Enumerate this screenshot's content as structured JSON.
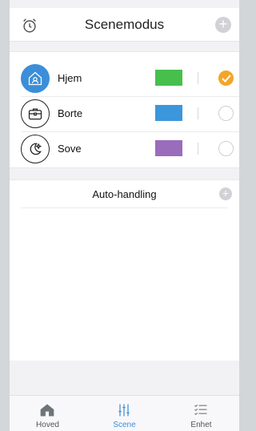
{
  "header": {
    "title": "Scenemodus",
    "add_label": "+"
  },
  "scenes": [
    {
      "label": "Hjem",
      "color": "#46bf4c",
      "selected": true,
      "icon": "home-outline-icon"
    },
    {
      "label": "Borte",
      "color": "#3c96dc",
      "selected": false,
      "icon": "briefcase-icon"
    },
    {
      "label": "Sove",
      "color": "#9a6cbc",
      "selected": false,
      "icon": "moon-star-icon"
    }
  ],
  "auto": {
    "label": "Auto-handling",
    "add_label": "+"
  },
  "tabs": [
    {
      "label": "Hoved",
      "icon": "home-icon",
      "active": false
    },
    {
      "label": "Scene",
      "icon": "sliders-icon",
      "active": true
    },
    {
      "label": "Enhet",
      "icon": "checklist-icon",
      "active": false
    }
  ],
  "colors": {
    "accent": "#3c8ed8",
    "check": "#f3a52a"
  }
}
